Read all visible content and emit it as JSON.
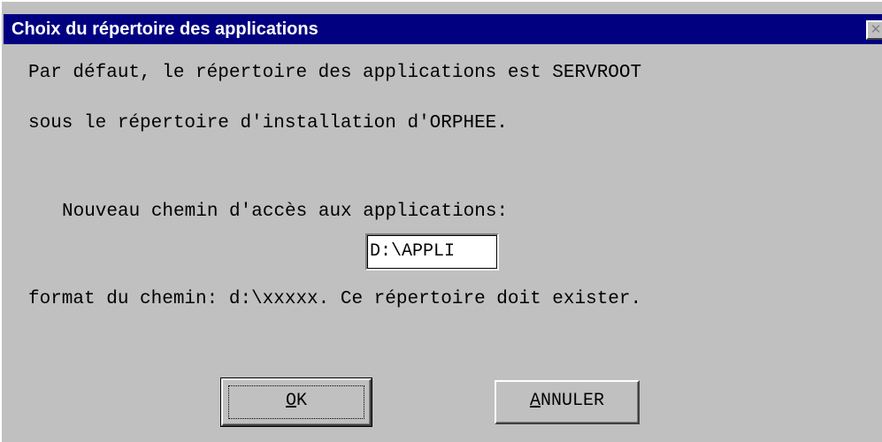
{
  "window": {
    "title": "Choix du répertoire des applications",
    "close_glyph": "✕"
  },
  "body": {
    "line1": "Par défaut, le répertoire des applications est SERVROOT",
    "line2": "sous le répertoire d'installation d'ORPHEE.",
    "path_label": "Nouveau chemin d'accès aux applications:",
    "path_value": "D:\\APPLI",
    "format_hint": "format du chemin: d:\\xxxxx. Ce répertoire doit exister."
  },
  "buttons": {
    "ok_mnemonic": "O",
    "ok_rest": "K",
    "cancel_mnemonic": "A",
    "cancel_rest": "NNULER"
  },
  "icons": {
    "close": "close-icon"
  },
  "colors": {
    "titlebar": "#000080",
    "face": "#c0c0c0",
    "title_text": "#ffffff"
  }
}
